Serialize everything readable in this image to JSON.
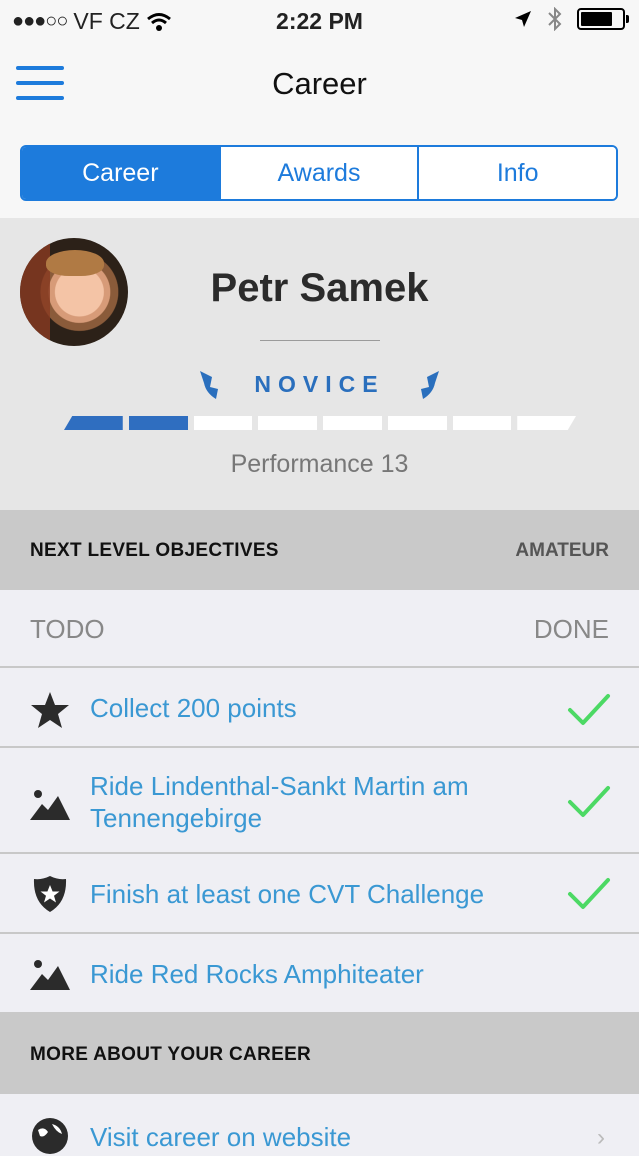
{
  "status": {
    "carrier": "VF CZ",
    "time": "2:22 PM"
  },
  "nav": {
    "title": "Career"
  },
  "tabs": [
    {
      "label": "Career",
      "active": true
    },
    {
      "label": "Awards",
      "active": false
    },
    {
      "label": "Info",
      "active": false
    }
  ],
  "profile": {
    "name": "Petr Samek",
    "level": "NOVICE",
    "performance": "Performance 13",
    "progress_filled": 2,
    "progress_total": 8
  },
  "objectives": {
    "header": "NEXT LEVEL OBJECTIVES",
    "next_level": "AMATEUR",
    "todo_label": "TODO",
    "done_label": "DONE",
    "items": [
      {
        "icon": "star-icon",
        "text": "Collect 200 points",
        "done": true
      },
      {
        "icon": "mountain-icon",
        "text": "Ride Lindenthal-Sankt Martin am Tennengebirge",
        "done": true
      },
      {
        "icon": "shield-star-icon",
        "text": "Finish at least one CVT Challenge",
        "done": true
      },
      {
        "icon": "mountain-icon",
        "text": "Ride Red Rocks Amphiteater",
        "done": false
      }
    ]
  },
  "more": {
    "header": "MORE ABOUT YOUR CAREER",
    "link": "Visit career on website"
  },
  "colors": {
    "accent": "#1d7bdc",
    "link": "#3a98d3",
    "check": "#4cd964",
    "level": "#2a6fbd"
  }
}
